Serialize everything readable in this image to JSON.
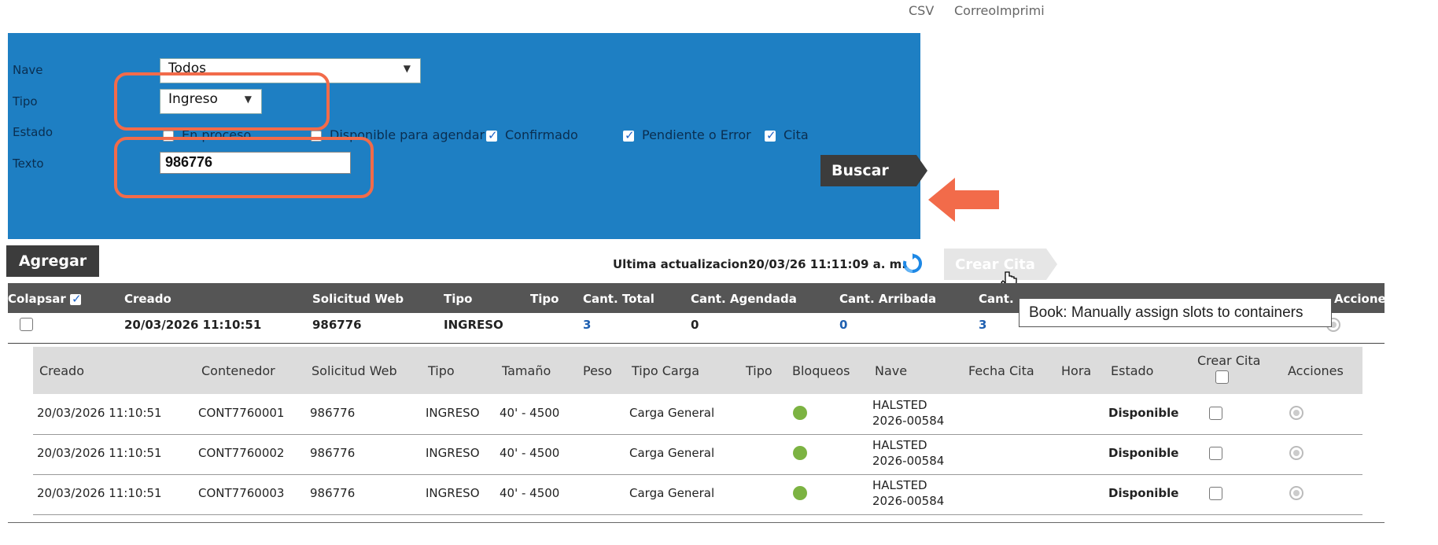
{
  "top_links": {
    "csv": "CSV",
    "correo": "CorreoImprimi"
  },
  "filter": {
    "nave": {
      "label": "Nave",
      "value": "Todos"
    },
    "tipo": {
      "label": "Tipo",
      "value": "Ingreso"
    },
    "estado": {
      "label": "Estado",
      "options": [
        {
          "label": "En proceso",
          "checked": false
        },
        {
          "label": "Disponible para agendar",
          "checked": false
        },
        {
          "label": "Confirmado",
          "checked": true
        },
        {
          "label": "Pendiente o Error",
          "checked": true
        },
        {
          "label": "Cita",
          "checked": true
        }
      ]
    },
    "texto": {
      "label": "Texto",
      "value": "986776"
    },
    "search_button": "Buscar"
  },
  "toolbar": {
    "add_button": "Agregar",
    "last_update_label": "Ultima actualizacion:",
    "last_update_value": "20/03/26 11:11:09 a. m.",
    "crear_cita_button": "Crear Cita",
    "tooltip": "Book: Manually assign slots to containers"
  },
  "main_table": {
    "headers": [
      "Colapsar",
      "Creado",
      "Solicitud Web",
      "Tipo",
      "Tipo",
      "Cant. Total",
      "Cant. Agendada",
      "Cant. Arribada",
      "Cant.",
      "Acciones"
    ],
    "row": {
      "creado": "20/03/2026 11:10:51",
      "solicitud": "986776",
      "tipo": "INGRESO",
      "cant_total": "3",
      "cant_agendada": "0",
      "cant_arribada": "0",
      "cant": "3"
    }
  },
  "detail_table": {
    "headers": [
      "Creado",
      "Contenedor",
      "Solicitud Web",
      "Tipo",
      "Tamaño",
      "Peso",
      "Tipo Carga",
      "Tipo",
      "Bloqueos",
      "Nave",
      "Fecha Cita",
      "Hora",
      "Estado",
      "Crear Cita",
      "Acciones"
    ],
    "rows": [
      {
        "creado": "20/03/2026 11:10:51",
        "contenedor": "CONT7760001",
        "solicitud": "986776",
        "tipo": "INGRESO",
        "tamano": "40' - 4500",
        "tipo_carga": "Carga General",
        "nave_1": "HALSTED",
        "nave_2": "2026-00584",
        "estado": "Disponible"
      },
      {
        "creado": "20/03/2026 11:10:51",
        "contenedor": "CONT7760002",
        "solicitud": "986776",
        "tipo": "INGRESO",
        "tamano": "40' - 4500",
        "tipo_carga": "Carga General",
        "nave_1": "HALSTED",
        "nave_2": "2026-00584",
        "estado": "Disponible"
      },
      {
        "creado": "20/03/2026 11:10:51",
        "contenedor": "CONT7760003",
        "solicitud": "986776",
        "tipo": "INGRESO",
        "tamano": "40' - 4500",
        "tipo_carga": "Carga General",
        "nave_1": "HALSTED",
        "nave_2": "2026-00584",
        "estado": "Disponible"
      }
    ]
  },
  "colors": {
    "panel": "#1e7fc3",
    "highlight": "#f26b4a",
    "header_dark": "#555555",
    "bloqueo_ok": "#7cb342"
  }
}
